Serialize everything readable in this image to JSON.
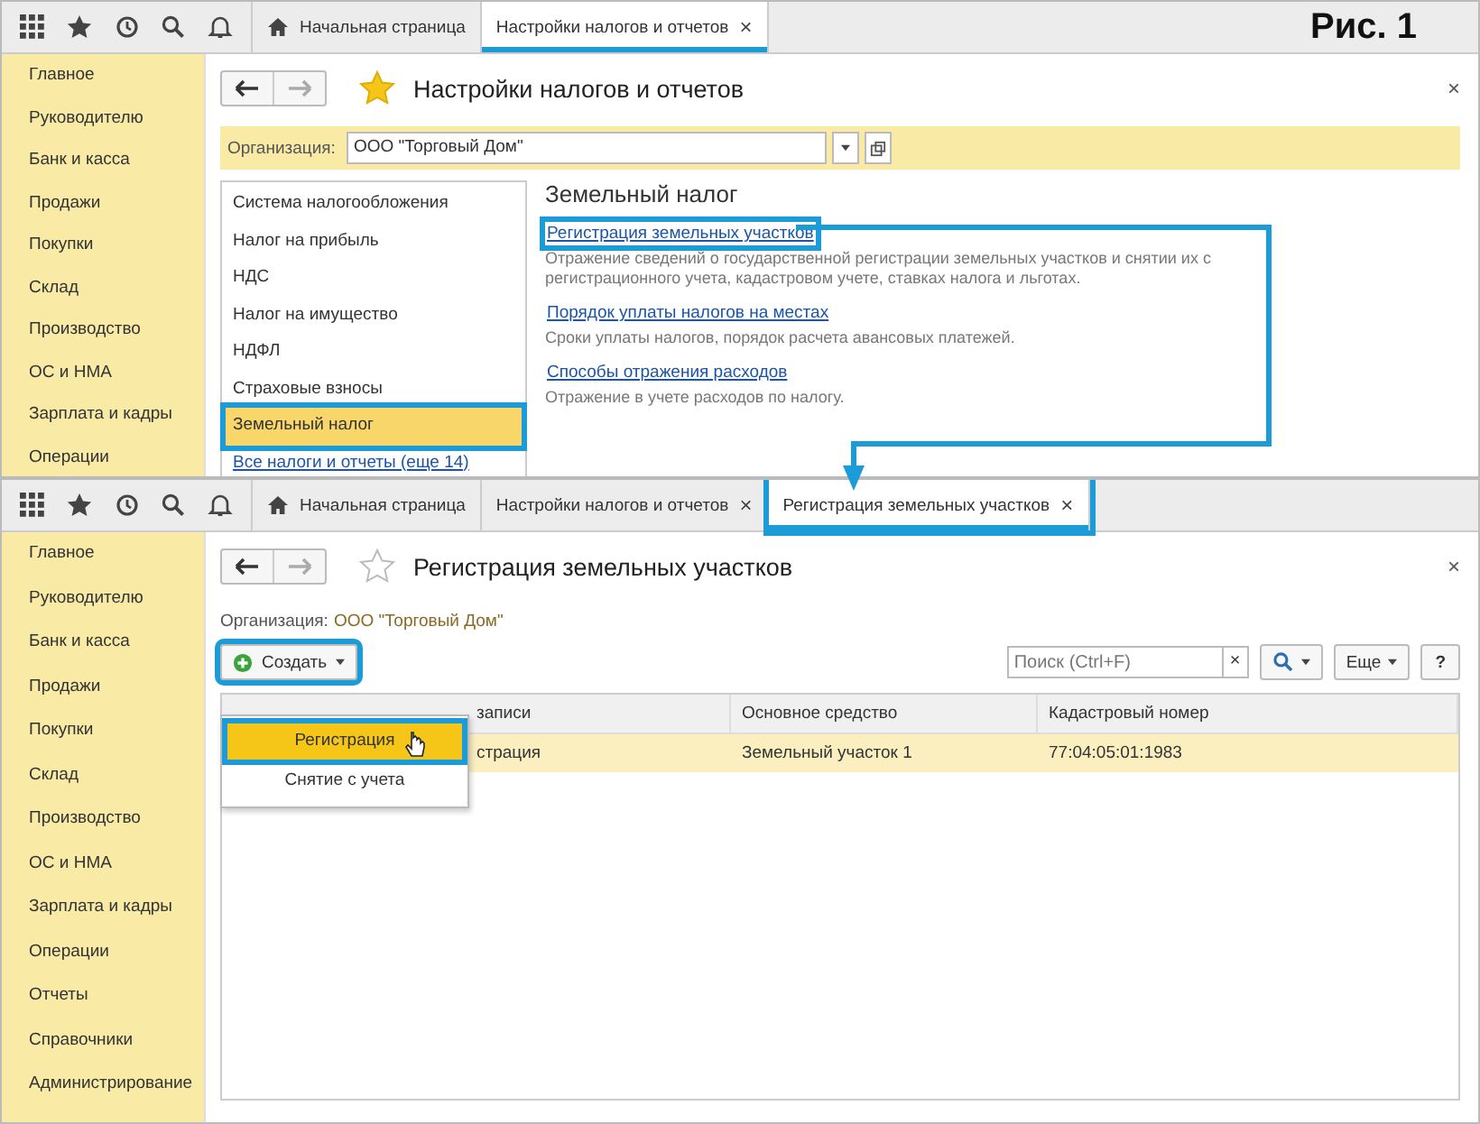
{
  "figure_label": "Рис. 1",
  "settings_window": {
    "tabs": [
      {
        "label": "Начальная страница",
        "kind": "home",
        "selected": false,
        "annotated": false
      },
      {
        "label": "Настройки налогов и отчетов",
        "kind": "page",
        "selected": true,
        "annotated": false,
        "close_mark": "×"
      }
    ],
    "sidebar": [
      "Главное",
      "Руководителю",
      "Банк и касса",
      "Продажи",
      "Покупки",
      "Склад",
      "Производство",
      "ОС и НМА",
      "Зарплата и кадры",
      "Операции"
    ],
    "title": "Настройки налогов и отчетов",
    "favorite": true,
    "close_mark": "×",
    "organization": {
      "label": "Организация:",
      "value": "ООО \"Торговый Дом\""
    },
    "sections": [
      {
        "label": "Система налогообложения",
        "selected": false,
        "annotated": false
      },
      {
        "label": "Налог на прибыль",
        "selected": false,
        "annotated": false
      },
      {
        "label": "НДС",
        "selected": false,
        "annotated": false
      },
      {
        "label": "Налог на имущество",
        "selected": false,
        "annotated": false
      },
      {
        "label": "НДФЛ",
        "selected": false,
        "annotated": false
      },
      {
        "label": "Страховые взносы",
        "selected": false,
        "annotated": false
      },
      {
        "label": "Земельный налог",
        "selected": true,
        "annotated": true
      }
    ],
    "all_link": "Все налоги и отчеты (еще 14)",
    "heading": "Земельный налог",
    "links": [
      {
        "label": "Регистрация земельных участков",
        "annotated": true,
        "description": "Отражение сведений о государственной регистрации земельных участков и снятии их с регистрационного учета, кадастровом учете, ставках налога и льготах."
      },
      {
        "label": "Порядок уплаты налогов на местах",
        "annotated": false,
        "description": "Сроки уплаты налогов, порядок расчета авансовых платежей."
      },
      {
        "label": "Способы отражения расходов",
        "annotated": false,
        "description": "Отражение в учете расходов по налогу."
      }
    ]
  },
  "register_window": {
    "tabs": [
      {
        "label": "Начальная страница",
        "kind": "home",
        "selected": false,
        "annotated": false
      },
      {
        "label": "Настройки налогов и отчетов",
        "kind": "page",
        "selected": false,
        "annotated": false,
        "close_mark": "×"
      },
      {
        "label": "Регистрация земельных участков",
        "kind": "page",
        "selected": true,
        "annotated": true,
        "close_mark": "×"
      }
    ],
    "sidebar": [
      "Главное",
      "Руководителю",
      "Банк и касса",
      "Продажи",
      "Покупки",
      "Склад",
      "Производство",
      "ОС и НМА",
      "Зарплата и кадры",
      "Операции",
      "Отчеты",
      "Справочники",
      "Администрирование"
    ],
    "title": "Регистрация земельных участков",
    "favorite": false,
    "close_mark": "×",
    "organization": {
      "label": "Организация:",
      "value": "ООО \"Торговый Дом\""
    },
    "create_button": {
      "label": "Создать",
      "annotated": true
    },
    "create_menu": [
      {
        "label": "Регистрация",
        "selected": true,
        "annotated": true
      },
      {
        "label": "Снятие с учета",
        "selected": false,
        "annotated": false
      }
    ],
    "search": {
      "placeholder": "Поиск (Ctrl+F)",
      "clear_mark": "×"
    },
    "more_button": "Еще",
    "help_button": "?",
    "table": {
      "columns": [
        "записи",
        "Основное средство",
        "Кадастровый номер"
      ],
      "rows": [
        {
          "cells": [
            "страция",
            "Земельный участок 1",
            "77:04:05:01:1983"
          ],
          "selected": true
        }
      ]
    }
  }
}
